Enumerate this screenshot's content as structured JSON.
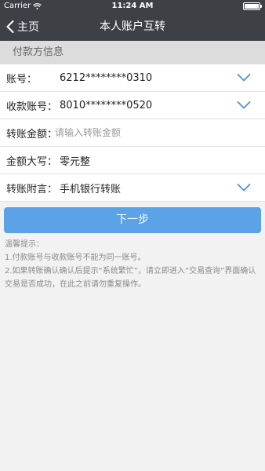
{
  "status_bar": {
    "carrier": "Carrier",
    "time": "11:24 AM",
    "wifi_icon": "wifi-icon",
    "battery_icon": "battery-icon"
  },
  "nav": {
    "back_label": "主页",
    "title": "本人账户互转"
  },
  "section": {
    "title": "付款方信息"
  },
  "form": {
    "account_label": "账号：",
    "account_value": "6212********0310",
    "payee_label": "收款账号：",
    "payee_value": "8010********0520",
    "amount_label": "转账金额：",
    "amount_placeholder": "请输入转账金额",
    "amount_value": "",
    "capital_label": "金额大写：",
    "capital_value": "零元整",
    "memo_label": "转账附言：",
    "memo_value": "手机银行转账"
  },
  "button": {
    "next_label": "下一步"
  },
  "tips": {
    "title": "温馨提示：",
    "line1": "1.付款账号与收款账号不能为同一账号。",
    "line2": "2.如果转账确认确认后提示“系统繁忙”，请立即进入“交易查询”界面确认交易是否成功，在此之前请勿重复操作。"
  },
  "colors": {
    "nav_bg": "#3d4045",
    "section_bg": "#dcdcdc",
    "accent": "#5ba3e6",
    "chevron": "#4a90d9",
    "tip_text": "#8a8a8a"
  }
}
